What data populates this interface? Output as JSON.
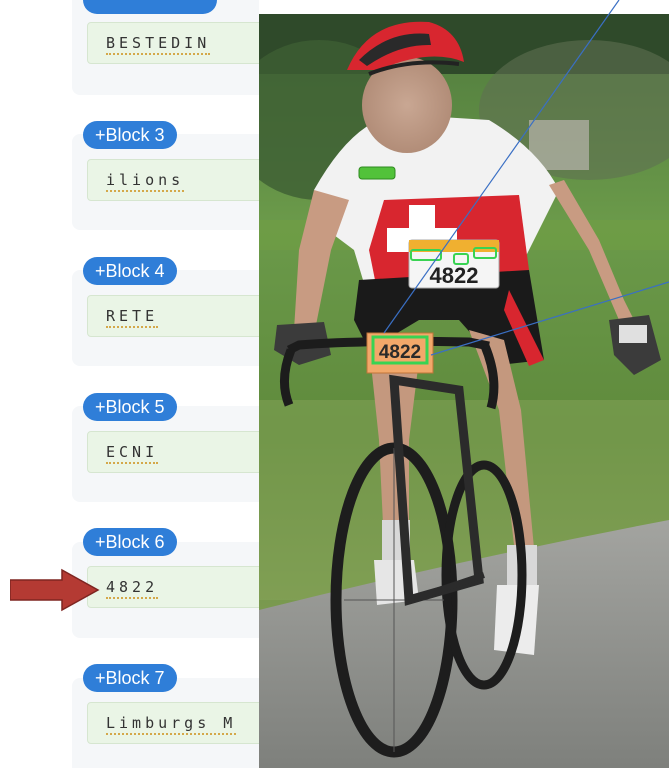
{
  "blocks": [
    {
      "badge": "",
      "text": "BESTEDIN"
    },
    {
      "badge": "+Block 3",
      "text": "ilions"
    },
    {
      "badge": "+Block 4",
      "text": "RETE"
    },
    {
      "badge": "+Block 5",
      "text": "ECNI"
    },
    {
      "badge": "+Block 6",
      "text": "4822"
    },
    {
      "badge": "+Block 7",
      "text": "Limburgs M"
    }
  ],
  "photo": {
    "bib_number": "4822",
    "frame_number": "4822",
    "box_color": "#39d353",
    "line_color": "#3a6fc4"
  },
  "colors": {
    "badge": "#2f7ed8",
    "text_box": "#eaf5e6",
    "arrow": "#b43a33"
  }
}
